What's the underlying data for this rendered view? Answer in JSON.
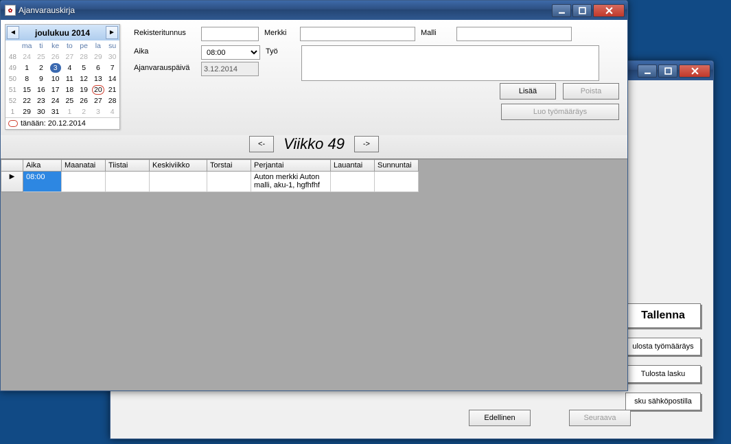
{
  "backWindow": {
    "buttons": {
      "save": "Tallenna",
      "printOrder": "ulosta työmääräys",
      "printInvoice": "Tulosta lasku",
      "emailInvoice": "sku sähköpostilla",
      "prev": "Edellinen",
      "next": "Seuraava"
    }
  },
  "frontWindow": {
    "title": "Ajanvarauskirja",
    "calendar": {
      "monthLabel": "joulukuu 2014",
      "dow": [
        "ma",
        "ti",
        "ke",
        "to",
        "pe",
        "la",
        "su"
      ],
      "weeks": [
        {
          "wk": "48",
          "days": [
            "24",
            "25",
            "26",
            "27",
            "28",
            "29",
            "30"
          ],
          "dim": true
        },
        {
          "wk": "49",
          "days": [
            "1",
            "2",
            "3",
            "4",
            "5",
            "6",
            "7"
          ],
          "sel": 2
        },
        {
          "wk": "50",
          "days": [
            "8",
            "9",
            "10",
            "11",
            "12",
            "13",
            "14"
          ]
        },
        {
          "wk": "51",
          "days": [
            "15",
            "16",
            "17",
            "18",
            "19",
            "20",
            "21"
          ],
          "today": 5
        },
        {
          "wk": "52",
          "days": [
            "22",
            "23",
            "24",
            "25",
            "26",
            "27",
            "28"
          ]
        },
        {
          "wk": "1",
          "days": [
            "29",
            "30",
            "31",
            "1",
            "2",
            "3",
            "4"
          ],
          "dimFrom": 3
        }
      ],
      "todayLabel": "tänään: 20.12.2014"
    },
    "form": {
      "labels": {
        "reg": "Rekisteritunnus",
        "merkki": "Merkki",
        "malli": "Malli",
        "aika": "Aika",
        "tyo": "Työ",
        "date": "Ajanvarauspäivä"
      },
      "values": {
        "reg": "",
        "merkki": "",
        "malli": "",
        "aika": "08:00",
        "date": "3.12.2014"
      },
      "buttons": {
        "add": "Lisää",
        "remove": "Poista",
        "createOrder": "Luo työmääräys"
      }
    },
    "week": {
      "title": "Viikko 49",
      "prev": "<-",
      "next": "->"
    },
    "grid": {
      "headers": [
        "Aika",
        "Maanatai",
        "Tiistai",
        "Keskiviikko",
        "Torstai",
        "Perjantai",
        "Lauantai",
        "Sunnuntai"
      ],
      "rows": [
        {
          "aika": "08:00",
          "cells": [
            "",
            "",
            "",
            "",
            "Auton merkki Auton malli, aku-1, hgfhfhf",
            "",
            ""
          ]
        }
      ]
    }
  }
}
